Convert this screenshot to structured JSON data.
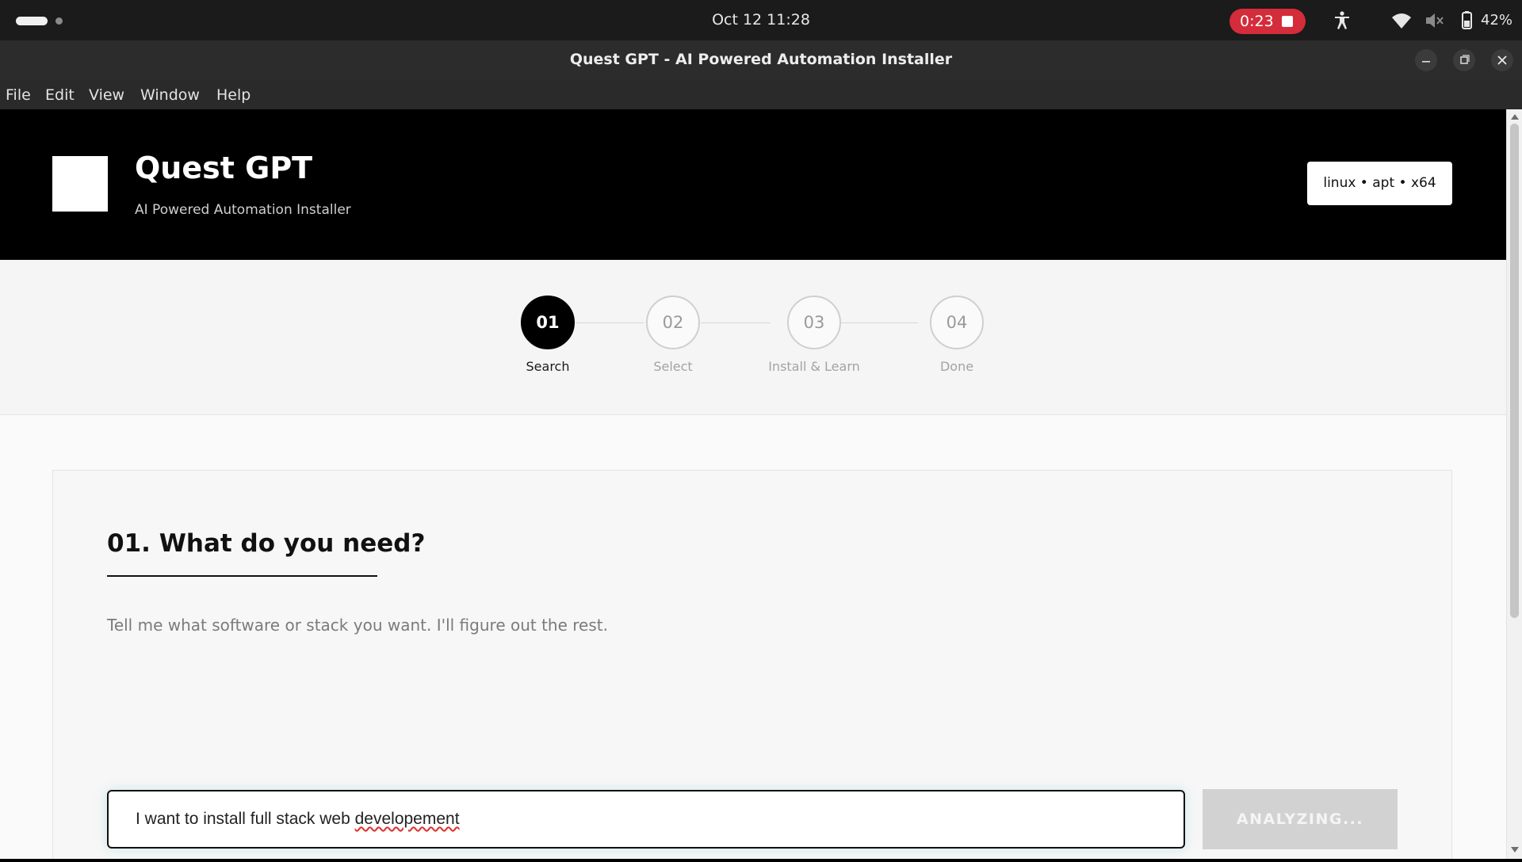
{
  "os": {
    "clock": "Oct 12  11:28",
    "recording_time": "0:23",
    "battery": "42%"
  },
  "window": {
    "title": "Quest GPT - AI Powered Automation Installer"
  },
  "menu": {
    "items": [
      "File",
      "Edit",
      "View",
      "Window",
      "Help"
    ]
  },
  "header": {
    "title": "Quest GPT",
    "subtitle": "AI Powered Automation Installer",
    "platform": "linux • apt • x64"
  },
  "stepper": {
    "steps": [
      {
        "number": "01",
        "label": "Search",
        "active": true
      },
      {
        "number": "02",
        "label": "Select",
        "active": false
      },
      {
        "number": "03",
        "label": "Install & Learn",
        "active": false
      },
      {
        "number": "04",
        "label": "Done",
        "active": false
      }
    ]
  },
  "search": {
    "heading": "01. What do you need?",
    "description": "Tell me what software or stack you want. I'll figure out the rest.",
    "value_prefix": "I want to install full stack web ",
    "value_misspelled": "developement",
    "button_label": "ANALYZING..."
  },
  "colors": {
    "accent": "#000000",
    "record": "#d42c3a",
    "button_disabled": "#d2d2d2"
  }
}
